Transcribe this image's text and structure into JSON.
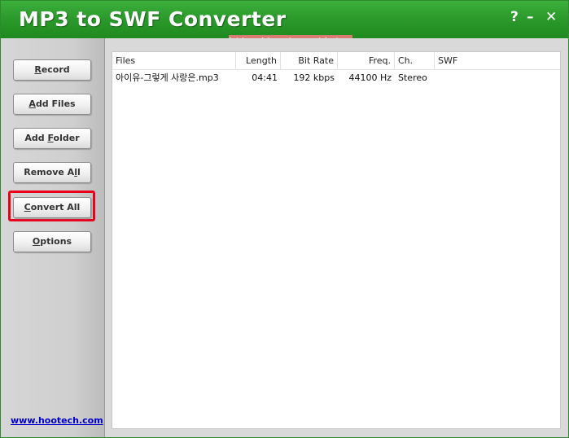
{
  "window": {
    "title": "MP3 to SWF Converter",
    "help": "?",
    "minimize": "–",
    "close": "✕",
    "watermark": "http://nextcom.tistory.com"
  },
  "sidebar": {
    "buttons": [
      {
        "u": "R",
        "rest": "ecord"
      },
      {
        "u": "A",
        "rest": "dd Files"
      },
      {
        "pre": "Add ",
        "u": "F",
        "rest": "older"
      },
      {
        "pre": "Remove A",
        "u": "l",
        "rest": "l"
      },
      {
        "u": "C",
        "rest": "onvert All"
      },
      {
        "u": "O",
        "rest": "ptions"
      }
    ],
    "link": "www.hootech.com"
  },
  "list": {
    "columns": [
      "Files",
      "Length",
      "Bit Rate",
      "Freq.",
      "Ch.",
      "SWF"
    ],
    "rows": [
      {
        "file": "아이유-그렇게 사랑은.mp3",
        "length": "04:41",
        "bitrate": "192 kbps",
        "freq": "44100 Hz",
        "ch": "Stereo",
        "swf": ""
      }
    ]
  },
  "colors": {
    "title_green": "#2c9a2c",
    "highlight_red": "#e8001c",
    "link_blue": "#0000cc",
    "watermark_bg": "#e87a7a"
  }
}
